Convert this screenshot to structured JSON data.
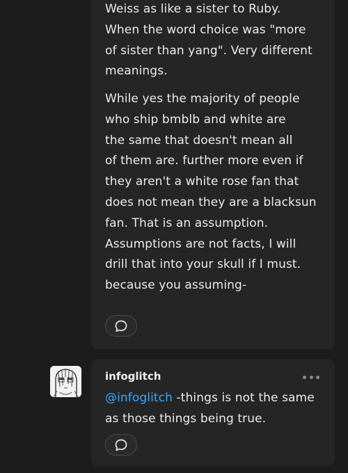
{
  "post1": {
    "paragraph1": [
      "Weiss as like a sister to Ruby.",
      "When the word choice was \"more",
      "of sister than yang\". Very different",
      "meanings."
    ],
    "paragraph2": [
      "While yes the majority of people",
      "who ship bmblb and white are",
      "the same that doesn't mean all",
      "of them are. further more even if",
      "they aren't a white rose fan that",
      "does not mean they are a blacksun",
      "fan. That is an assumption.",
      "Assumptions are not facts, I will",
      "drill that into your skull if I must.",
      "because you assuming-"
    ]
  },
  "post2": {
    "username": "infoglitch",
    "mention": "@infoglitch",
    "line1_rest": " -things is not the same",
    "line2": "as those things being true."
  },
  "icons": {
    "reply": "speech-bubble-icon",
    "more": "more-dots-icon",
    "avatar": "anime-avatar"
  },
  "colors": {
    "background": "#1c1c1c",
    "card": "#252525",
    "mention": "#3aa7ff"
  }
}
